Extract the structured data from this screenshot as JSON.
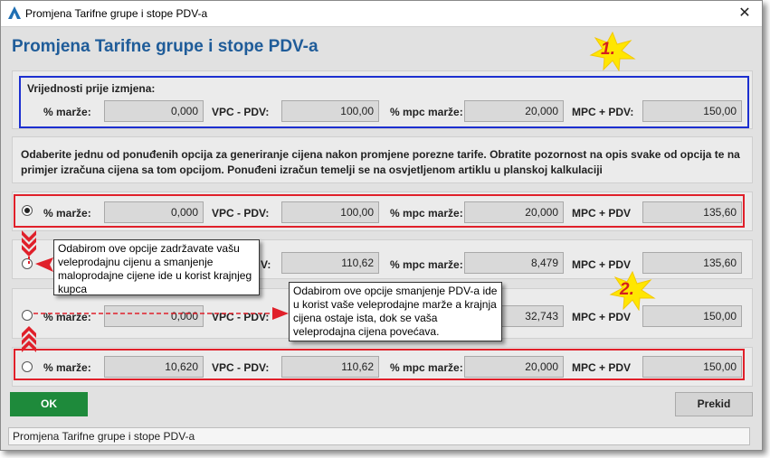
{
  "window": {
    "title": "Promjena Tarifne grupe i stope PDV-a",
    "close_symbol": "✕"
  },
  "heading": "Promjena Tarifne grupe i stope PDV-a",
  "before": {
    "section_label": "Vrijednosti prije izmjena:",
    "marza_label": "% marže:",
    "marza": "0,000",
    "vpc_label": "VPC - PDV:",
    "vpc": "100,00",
    "mpc_marza_label": "% mpc marže:",
    "mpc_marza": "20,000",
    "mpc_label": "MPC + PDV:",
    "mpc": "150,00"
  },
  "description": "Odaberite jednu od ponuđenih opcija za generiranje cijena nakon promjene porezne tarife. Obratite pozornost na opis svake od opcija te na primjer izračuna cijena sa tom opcijom. Ponuđeni izračun temelji se na osvjetljenom artiklu u planskoj kalkulaciji",
  "options": [
    {
      "selected": true,
      "marza_label": "% marže:",
      "marza": "0,000",
      "vpc_label": "VPC - PDV:",
      "vpc": "100,00",
      "mpc_marza_label": "% mpc marže:",
      "mpc_marza": "20,000",
      "mpc_label": "MPC + PDV",
      "mpc": "135,60"
    },
    {
      "selected": false,
      "vpc_label_tail": "V:",
      "vpc": "110,62",
      "mpc_marza_label": "% mpc marže:",
      "mpc_marza": "8,479",
      "mpc_label": "MPC + PDV",
      "mpc": "135,60"
    },
    {
      "selected": false,
      "marza_label": "% marže:",
      "marza": "0,000",
      "vpc_label": "VPC - PDV:",
      "mpc_marza": "32,743",
      "mpc_label": "MPC + PDV",
      "mpc": "150,00"
    },
    {
      "selected": false,
      "marza_label": "% marže:",
      "marza": "10,620",
      "vpc_label": "VPC - PDV:",
      "vpc": "110,62",
      "mpc_marza_label": "% mpc marže:",
      "mpc_marza": "20,000",
      "mpc_label": "MPC + PDV",
      "mpc": "150,00"
    }
  ],
  "callouts": {
    "first": "Odabirom ove opcije zadržavate vašu veleprodajnu cijenu a smanjenje maloprodajne cijene ide u korist krajnjeg kupca",
    "second": "Odabirom ove opcije smanjenje PDV-a ide u korist vaše veleprodajne marže a krajnja cijena ostaje ista, dok se vaša veleprodajna cijena povećava."
  },
  "badges": {
    "one": "1.",
    "two": "2."
  },
  "buttons": {
    "ok": "OK",
    "cancel": "Prekid"
  },
  "status": "Promjena Tarifne grupe i stope PDV-a",
  "colors": {
    "heading": "#1f5c99",
    "highlight_red": "#e0202a",
    "highlight_blue": "#1c2fd0",
    "ok_green": "#1e8a3b",
    "badge_yellow": "#ffe600"
  }
}
